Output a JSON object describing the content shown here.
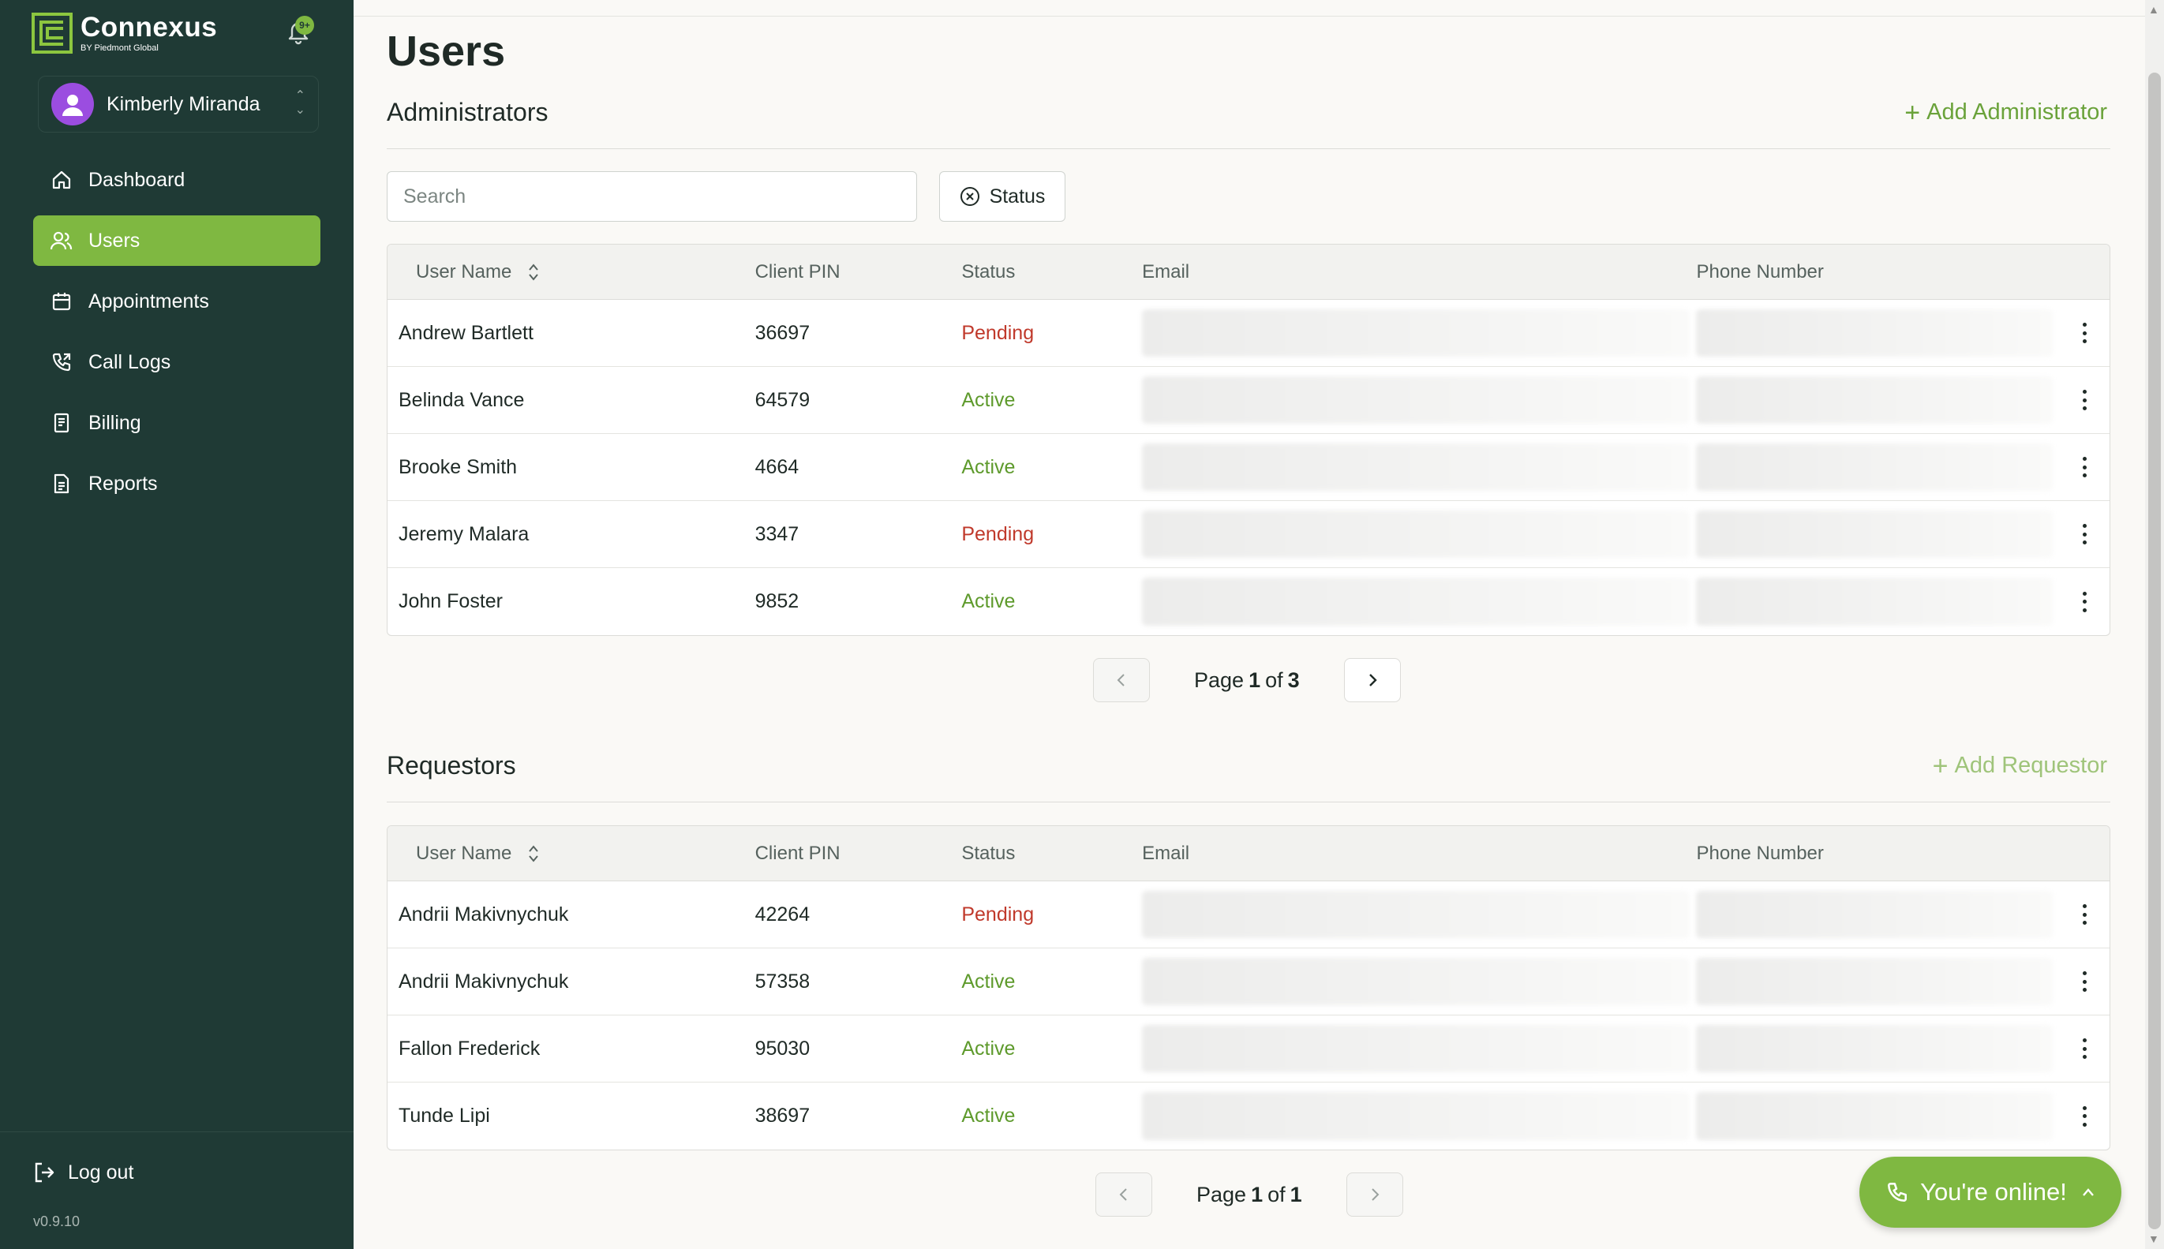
{
  "brand": {
    "name": "Connexus",
    "sub": "BY Piedmont Global",
    "notif_badge": "9+"
  },
  "user": {
    "name": "Kimberly Miranda"
  },
  "nav": {
    "items": [
      {
        "label": "Dashboard",
        "icon": "home-icon"
      },
      {
        "label": "Users",
        "icon": "users-icon",
        "active": true
      },
      {
        "label": "Appointments",
        "icon": "calendar-icon"
      },
      {
        "label": "Call Logs",
        "icon": "phone-icon"
      },
      {
        "label": "Billing",
        "icon": "receipt-icon"
      },
      {
        "label": "Reports",
        "icon": "document-icon"
      }
    ],
    "logout": "Log out",
    "version": "v0.9.10"
  },
  "page": {
    "title": "Users"
  },
  "administrators": {
    "title": "Administrators",
    "add_label": "Add Administrator",
    "search_placeholder": "Search",
    "status_filter": "Status",
    "columns": {
      "name": "User Name",
      "pin": "Client PIN",
      "status": "Status",
      "email": "Email",
      "phone": "Phone Number"
    },
    "rows": [
      {
        "name": "Andrew Bartlett",
        "pin": "36697",
        "status": "Pending"
      },
      {
        "name": "Belinda Vance",
        "pin": "64579",
        "status": "Active"
      },
      {
        "name": "Brooke Smith",
        "pin": "4664",
        "status": "Active"
      },
      {
        "name": "Jeremy Malara",
        "pin": "3347",
        "status": "Pending"
      },
      {
        "name": "John Foster",
        "pin": "9852",
        "status": "Active"
      }
    ],
    "pager": {
      "prefix": "Page",
      "current": "1",
      "of": "of",
      "total": "3"
    }
  },
  "requestors": {
    "title": "Requestors",
    "add_label": "Add Requestor",
    "columns": {
      "name": "User Name",
      "pin": "Client PIN",
      "status": "Status",
      "email": "Email",
      "phone": "Phone Number"
    },
    "rows": [
      {
        "name": "Andrii Makivnychuk",
        "pin": "42264",
        "status": "Pending"
      },
      {
        "name": "Andrii Makivnychuk",
        "pin": "57358",
        "status": "Active"
      },
      {
        "name": "Fallon Frederick",
        "pin": "95030",
        "status": "Active"
      },
      {
        "name": "Tunde Lipi",
        "pin": "38697",
        "status": "Active"
      }
    ],
    "pager": {
      "prefix": "Page",
      "current": "1",
      "of": "of",
      "total": "1"
    }
  },
  "online_pill": {
    "label": "You're online!"
  },
  "colors": {
    "sidebar": "#1f3a35",
    "accent": "#7fb841",
    "pending": "#c0392b",
    "active": "#5e9a2c"
  }
}
